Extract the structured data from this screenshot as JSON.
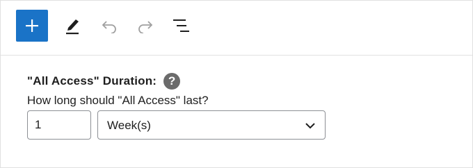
{
  "toolbar": {
    "add_icon": "plus-icon",
    "edit_icon": "pencil-icon",
    "undo_icon": "undo-icon",
    "redo_icon": "redo-icon",
    "outline_icon": "list-view-icon",
    "accent_color": "#1a73c7"
  },
  "field": {
    "heading": "\"All Access\" Duration:",
    "help_icon": "?",
    "description": "How long should \"All Access\" last?",
    "quantity_value": "1",
    "unit_selected": "Week(s)"
  }
}
